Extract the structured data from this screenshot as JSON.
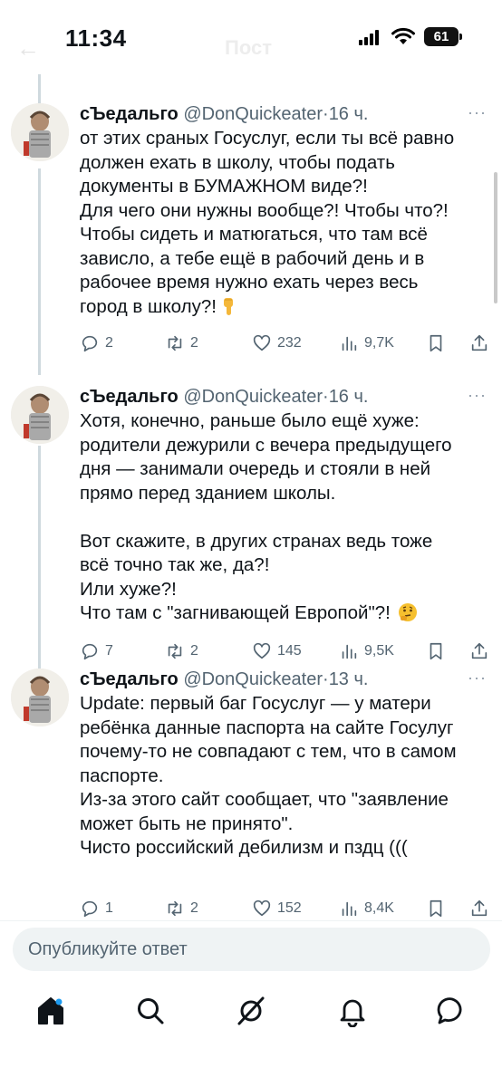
{
  "status_bar": {
    "time": "11:34",
    "battery": "61",
    "back_glyph": "←",
    "faded_title": "Пост"
  },
  "tweets": [
    {
      "author": "сЪедальго",
      "handle": "@DonQuickeater",
      "separator": "·",
      "time": "16 ч.",
      "lines": [
        "от этих сраных Госуслуг, если ты всё равно",
        "должен ехать в школу, чтобы подать",
        "документы в БУМАЖНОМ виде?!",
        "Для чего они нужны вообще?! Чтобы что?!",
        "Чтобы сидеть и матюгаться, что там всё",
        "зависло, а тебе ещё в рабочий день и в",
        "рабочее время нужно ехать через весь",
        "город в школу?!"
      ],
      "emoji": "pointing-down-hand",
      "replies": "2",
      "reposts": "2",
      "likes": "232",
      "views": "9,7K"
    },
    {
      "author": "сЪедальго",
      "handle": "@DonQuickeater",
      "separator": "·",
      "time": "16 ч.",
      "lines": [
        "Хотя, конечно, раньше было ещё хуже:",
        "родители дежурили с вечера предыдущего",
        "дня — занимали очередь и стояли в ней",
        "прямо перед зданием школы.",
        "",
        "Вот скажите, в других странах ведь тоже",
        "всё точно так же, да?!",
        "Или хуже?!",
        "Что там с \"загнивающей Европой\"?!"
      ],
      "emoji": "thinking-face",
      "replies": "7",
      "reposts": "2",
      "likes": "145",
      "views": "9,5K"
    },
    {
      "author": "сЪедальго",
      "handle": "@DonQuickeater",
      "separator": "·",
      "time": "13 ч.",
      "lines": [
        "Update: первый баг Госуслуг — у матери",
        "ребёнка данные паспорта на сайте Госулуг",
        "почему-то не совпадают с тем, что в самом",
        "паспорте.",
        "Из-за этого сайт сообщает, что \"заявление",
        "может быть не принято\".",
        "Чисто российский дебилизм и пздц ((("
      ],
      "emoji": "",
      "replies": "1",
      "reposts": "2",
      "likes": "152",
      "views": "8,4K"
    }
  ],
  "reply": {
    "placeholder": "Опубликуйте ответ"
  },
  "nav": [
    "home-icon",
    "search-icon",
    "grok-icon",
    "notifications-icon",
    "messages-icon"
  ],
  "colors": {
    "text": "#0f1419",
    "secondary": "#536471",
    "thread_line": "#cfd9de",
    "reply_bg": "#eff3f4"
  }
}
